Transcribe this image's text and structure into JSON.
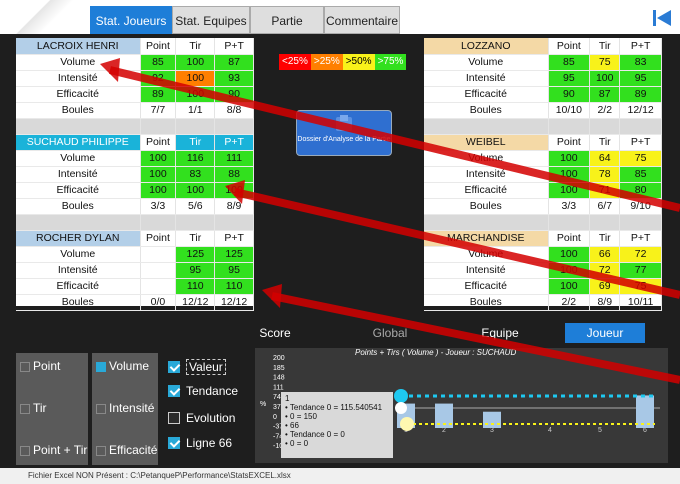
{
  "tabs": [
    "Stat. Joueurs",
    "Stat. Equipes",
    "Partie",
    "Commentaire"
  ],
  "left_players": [
    {
      "name": "LACROIX HENRI",
      "head_style": "blue",
      "headers": [
        "Point",
        "Tir",
        "P+T"
      ],
      "rows": [
        [
          "Volume",
          "85",
          "100",
          "87"
        ],
        [
          "Intensité",
          "92",
          "100",
          "93"
        ],
        [
          "Efficacité",
          "89",
          "100",
          "90"
        ],
        [
          "Boules",
          "7/7",
          "1/1",
          "8/8"
        ]
      ],
      "colors": [
        [
          "g",
          "g",
          "g"
        ],
        [
          "g",
          "o",
          "g"
        ],
        [
          "g",
          "g",
          "g"
        ],
        [
          "",
          "",
          ""
        ]
      ]
    },
    {
      "name": "SUCHAUD PHILIPPE",
      "head_style": "cyan",
      "headers": [
        "Point",
        "Tir",
        "P+T"
      ],
      "rows": [
        [
          "Volume",
          "100",
          "116",
          "111"
        ],
        [
          "Intensité",
          "100",
          "83",
          "88"
        ],
        [
          "Efficacité",
          "100",
          "100",
          "100"
        ],
        [
          "Boules",
          "3/3",
          "5/6",
          "8/9"
        ]
      ],
      "colors": [
        [
          "g",
          "g",
          "g"
        ],
        [
          "g",
          "g",
          "g"
        ],
        [
          "g",
          "g",
          "g"
        ],
        [
          "",
          "",
          ""
        ]
      ]
    },
    {
      "name": "ROCHER DYLAN",
      "head_style": "blue",
      "headers": [
        "Point",
        "Tir",
        "P+T"
      ],
      "rows": [
        [
          "Volume",
          "",
          "125",
          "125"
        ],
        [
          "Intensité",
          "",
          "95",
          "95"
        ],
        [
          "Efficacité",
          "",
          "110",
          "110"
        ],
        [
          "Boules",
          "0/0",
          "12/12",
          "12/12"
        ]
      ],
      "colors": [
        [
          "",
          "g",
          "g"
        ],
        [
          "",
          "g",
          "g"
        ],
        [
          "",
          "g",
          "g"
        ],
        [
          "",
          "",
          ""
        ]
      ]
    }
  ],
  "right_players": [
    {
      "name": "LOZZANO",
      "headers": [
        "Point",
        "Tir",
        "P+T"
      ],
      "rows": [
        [
          "Volume",
          "85",
          "75",
          "83"
        ],
        [
          "Intensité",
          "95",
          "100",
          "95"
        ],
        [
          "Efficacité",
          "90",
          "87",
          "89"
        ],
        [
          "Boules",
          "10/10",
          "2/2",
          "12/12"
        ]
      ],
      "colors": [
        [
          "g",
          "y",
          "g"
        ],
        [
          "g",
          "g",
          "g"
        ],
        [
          "g",
          "g",
          "g"
        ],
        [
          "",
          "",
          ""
        ]
      ]
    },
    {
      "name": "WEIBEL",
      "headers": [
        "Point",
        "Tir",
        "P+T"
      ],
      "rows": [
        [
          "Volume",
          "100",
          "64",
          "75"
        ],
        [
          "Intensité",
          "100",
          "78",
          "85"
        ],
        [
          "Efficacité",
          "100",
          "71",
          "80"
        ],
        [
          "Boules",
          "3/3",
          "6/7",
          "9/10"
        ]
      ],
      "colors": [
        [
          "g",
          "y",
          "y"
        ],
        [
          "g",
          "y",
          "g"
        ],
        [
          "g",
          "y",
          "g"
        ],
        [
          "",
          "",
          ""
        ]
      ]
    },
    {
      "name": "MARCHANDISE",
      "headers": [
        "Point",
        "Tir",
        "P+T"
      ],
      "rows": [
        [
          "Volume",
          "100",
          "66",
          "72"
        ],
        [
          "Intensité",
          "100",
          "72",
          "77"
        ],
        [
          "Efficacité",
          "100",
          "69",
          "75"
        ],
        [
          "Boules",
          "2/2",
          "8/9",
          "10/11"
        ]
      ],
      "colors": [
        [
          "g",
          "y",
          "y"
        ],
        [
          "g",
          "y",
          "g"
        ],
        [
          "g",
          "y",
          "y"
        ],
        [
          "",
          "",
          ""
        ]
      ]
    }
  ],
  "legend": [
    {
      "label": "<25%",
      "color": "#ff0000"
    },
    {
      "label": ">25%",
      "color": "#ff7f00"
    },
    {
      "label": ">50%",
      "color": "#f8f21a",
      "text": "#000"
    },
    {
      "label": ">75%",
      "color": "#32e01e"
    }
  ],
  "dossier_label": "Dossier d'Analyse de la Partie",
  "bottom_tabs": [
    "Score",
    "Global",
    "Equipe",
    "Joueur"
  ],
  "left_controls": {
    "point": "Point",
    "volume": "Volume",
    "tir": "Tir",
    "intensite": "Intensité",
    "point_tir": "Point + Tir",
    "efficacite": "Efficacité"
  },
  "options": [
    {
      "label": "Valeur",
      "checked": true
    },
    {
      "label": "Tendance",
      "checked": true
    },
    {
      "label": "Evolution",
      "checked": false
    },
    {
      "label": "Ligne 66",
      "checked": true
    }
  ],
  "chart_data": {
    "type": "bar",
    "title": "Points + Tirs ( Volume )  -  Joueur : SUCHAUD",
    "categories": [
      "1",
      "2",
      "3",
      "4",
      "5",
      "6"
    ],
    "values": [
      111,
      111,
      74,
      null,
      null,
      148
    ],
    "y_ticks": [
      "200",
      "185",
      "148",
      "111",
      "74",
      "37",
      "0",
      "-37",
      "-74",
      "-100"
    ],
    "ylabel": "%"
  },
  "tooltip": [
    "1",
    "Tendance 0 = 115.540541",
    "0 = 150",
    "66",
    "Tendance 0 = 0",
    "0 = 0"
  ],
  "status": "Fichier Excel NON Présent : C:\\PetanqueP\\Performance\\StatsEXCEL.xlsx"
}
